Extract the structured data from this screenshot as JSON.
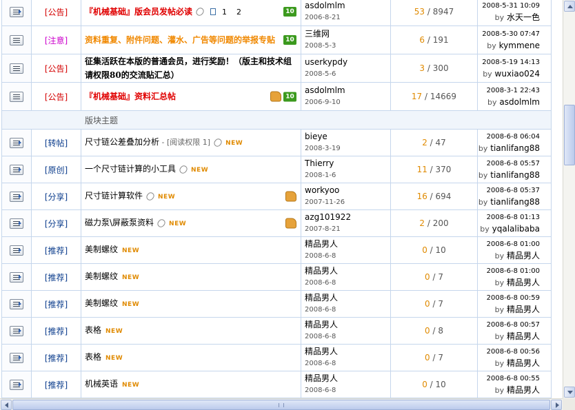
{
  "section_label": "版块主题",
  "colors": {
    "replies": "#e08a00",
    "border": "#c5d6ec",
    "type_red": "#d40000",
    "type_blue": "#0b3c8c",
    "type_magenta": "#cc00cc"
  },
  "pinned": [
    {
      "icon": "pinned-thread-icon",
      "type": "[公告]",
      "type_color": "red",
      "title": "『机械基础』版会员发帖必读",
      "title_style": "bold-red",
      "has_attachment": true,
      "pages": [
        "1",
        "2"
      ],
      "badges": [
        "up"
      ],
      "author": "asdolmlm",
      "author_date": "2006-8-21",
      "replies": "53",
      "views": "8947",
      "last_date": "2008-5-31 10:09",
      "last_by": "水天一色"
    },
    {
      "icon": "thread-icon",
      "type": "[注意]",
      "type_color": "magenta",
      "title": "资料重复、附件问题、灌水、广告等问题的举报专贴",
      "title_style": "bold-orange",
      "badges": [
        "up"
      ],
      "author": "三维网",
      "author_date": "2008-5-3",
      "replies": "6",
      "views": "191",
      "last_date": "2008-5-30 07:47",
      "last_by": "kymmene"
    },
    {
      "icon": "thread-icon",
      "type": "[公告]",
      "type_color": "red",
      "title": "征集活跃在本版的普通会员，进行奖励！（版主和技术组请权限80的交流贴汇总）",
      "title_style": "bold-black",
      "badges": [],
      "author": "userkypdy",
      "author_date": "2008-5-6",
      "replies": "3",
      "views": "300",
      "last_date": "2008-5-19 14:13",
      "last_by": "wuxiao024"
    },
    {
      "icon": "thread-icon",
      "type": "[公告]",
      "type_color": "red",
      "title": "『机械基础』资料汇总帖",
      "title_style": "bold-red",
      "badges": [
        "thumb",
        "up"
      ],
      "author": "asdolmlm",
      "author_date": "2006-9-10",
      "replies": "17",
      "views": "14669",
      "last_date": "2008-3-1 22:43",
      "last_by": "asdolmlm"
    }
  ],
  "threads": [
    {
      "type": "[转帖]",
      "title": "尺寸链公差叠加分析",
      "perm": " - [阅读权限  1]",
      "clip": true,
      "new": "NEW",
      "thumb": false,
      "author": "bieye",
      "author_date": "2008-3-19",
      "replies": "2",
      "views": "47",
      "last_date": "2008-6-8 06:04",
      "last_by": "tianlifang88"
    },
    {
      "type": "[原创]",
      "title": "一个尺寸链计算的小工具",
      "perm": "",
      "clip": true,
      "new": "NEW",
      "thumb": false,
      "author": "Thierry",
      "author_date": "2008-1-6",
      "replies": "11",
      "views": "370",
      "last_date": "2008-6-8 05:57",
      "last_by": "tianlifang88"
    },
    {
      "type": "[分享]",
      "title": "尺寸链计算软件",
      "perm": "",
      "clip": true,
      "new": "NEW",
      "thumb": true,
      "author": "workyoo",
      "author_date": "2007-11-26",
      "replies": "16",
      "views": "694",
      "last_date": "2008-6-8 05:37",
      "last_by": "tianlifang88"
    },
    {
      "type": "[分享]",
      "title": "磁力泵\\屏蔽泵资料",
      "perm": "",
      "clip": true,
      "new": "NEW",
      "thumb": true,
      "author": "azg101922",
      "author_date": "2007-8-21",
      "replies": "2",
      "views": "200",
      "last_date": "2008-6-8 01:13",
      "last_by": "yqalalibaba"
    },
    {
      "type": "[推荐]",
      "title": "美制螺纹",
      "perm": "",
      "clip": false,
      "new": "NEW",
      "thumb": false,
      "author": "精品男人",
      "author_date": "2008-6-8",
      "replies": "0",
      "views": "10",
      "last_date": "2008-6-8 01:00",
      "last_by": "精品男人"
    },
    {
      "type": "[推荐]",
      "title": "美制螺纹",
      "perm": "",
      "clip": false,
      "new": "NEW",
      "thumb": false,
      "author": "精品男人",
      "author_date": "2008-6-8",
      "replies": "0",
      "views": "7",
      "last_date": "2008-6-8 01:00",
      "last_by": "精品男人"
    },
    {
      "type": "[推荐]",
      "title": "美制螺纹",
      "perm": "",
      "clip": false,
      "new": "NEW",
      "thumb": false,
      "author": "精品男人",
      "author_date": "2008-6-8",
      "replies": "0",
      "views": "7",
      "last_date": "2008-6-8 00:59",
      "last_by": "精品男人"
    },
    {
      "type": "[推荐]",
      "title": "表格",
      "perm": "",
      "clip": false,
      "new": "NEW",
      "thumb": false,
      "author": "精品男人",
      "author_date": "2008-6-8",
      "replies": "0",
      "views": "8",
      "last_date": "2008-6-8 00:57",
      "last_by": "精品男人"
    },
    {
      "type": "[推荐]",
      "title": "表格",
      "perm": "",
      "clip": false,
      "new": "NEW",
      "thumb": false,
      "author": "精品男人",
      "author_date": "2008-6-8",
      "replies": "0",
      "views": "7",
      "last_date": "2008-6-8 00:56",
      "last_by": "精品男人"
    },
    {
      "type": "[推荐]",
      "title": "机械英语",
      "perm": "",
      "clip": false,
      "new": "NEW",
      "thumb": false,
      "author": "精品男人",
      "author_date": "2008-6-8",
      "replies": "0",
      "views": "10",
      "last_date": "2008-6-8 00:55",
      "last_by": "精品男人"
    }
  ],
  "labels": {
    "by": "by",
    "up_badge": "10",
    "slash": " / "
  }
}
